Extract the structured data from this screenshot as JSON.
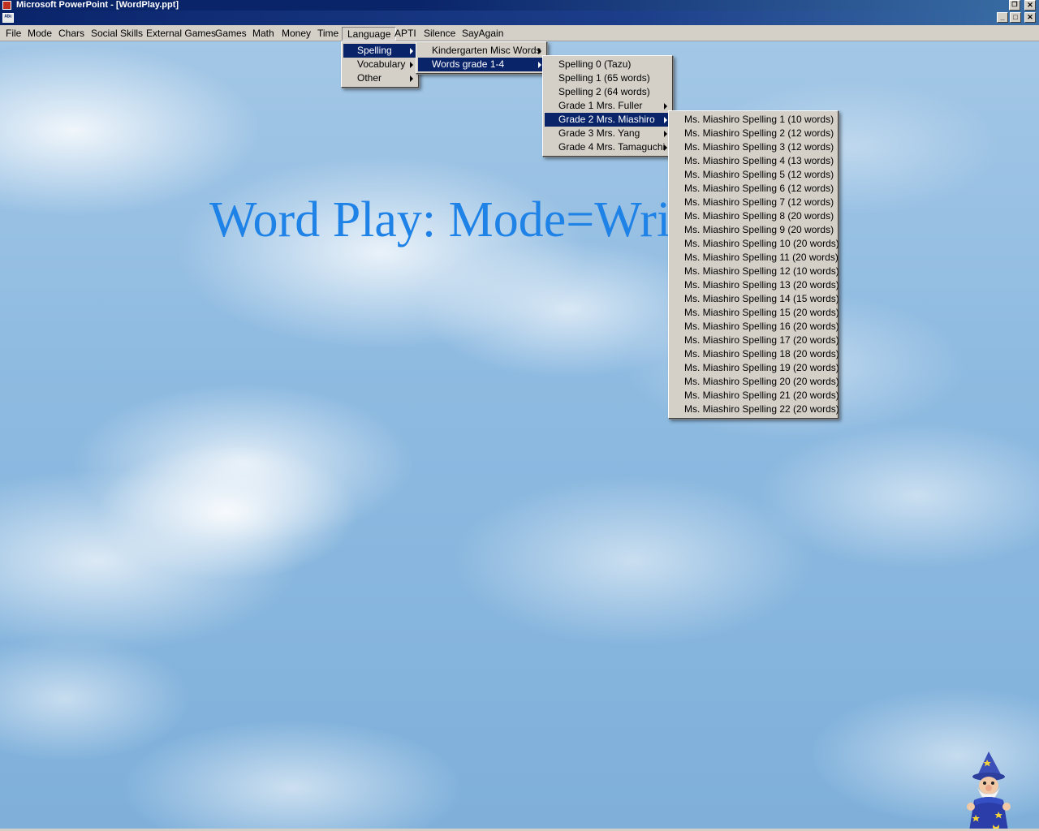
{
  "window": {
    "title": "Microsoft PowerPoint - [WordPlay.ppt]",
    "doc_icon_label": "ᴬᴮᶜ"
  },
  "menubar": {
    "items": [
      "File",
      "Mode",
      "Chars",
      "Social Skills",
      "External Games",
      "Games",
      "Math",
      "Money",
      "Time",
      "Language",
      "APTI",
      "Silence",
      "SayAgain"
    ],
    "active": "Language"
  },
  "language_menu": {
    "items": [
      {
        "label": "Spelling",
        "submenu": true,
        "selected": true
      },
      {
        "label": "Vocabulary",
        "submenu": true
      },
      {
        "label": "Other",
        "submenu": true
      }
    ]
  },
  "spelling_menu": {
    "items": [
      {
        "label": "Kindergarten Misc Words",
        "submenu": true
      },
      {
        "label": "Words grade 1-4",
        "submenu": true,
        "selected": true
      }
    ]
  },
  "grades_menu": {
    "items": [
      {
        "label": "Spelling 0 (Tazu)"
      },
      {
        "label": "Spelling 1 (65 words)"
      },
      {
        "label": "Spelling 2 (64 words)"
      },
      {
        "label": "Grade 1 Mrs. Fuller",
        "submenu": true
      },
      {
        "label": "Grade 2 Mrs. Miashiro",
        "submenu": true,
        "selected": true
      },
      {
        "label": "Grade 3 Mrs. Yang",
        "submenu": true
      },
      {
        "label": "Grade 4 Mrs. Tamaguchi",
        "submenu": true
      }
    ]
  },
  "miashiro_menu": {
    "items": [
      "Ms. Miashiro Spelling 1 (10 words)",
      "Ms. Miashiro Spelling 2 (12 words)",
      "Ms. Miashiro Spelling 3 (12 words)",
      "Ms. Miashiro Spelling 4 (13 words)",
      "Ms. Miashiro Spelling 5 (12 words)",
      "Ms. Miashiro Spelling 6 (12 words)",
      "Ms. Miashiro Spelling 7 (12 words)",
      "Ms. Miashiro Spelling 8 (20 words)",
      "Ms. Miashiro Spelling 9 (20 words)",
      "Ms. Miashiro Spelling 10 (20 words)",
      "Ms. Miashiro Spelling 11 (20 words)",
      "Ms. Miashiro Spelling 12 (10 words)",
      "Ms. Miashiro Spelling 13 (20 words)",
      "Ms. Miashiro Spelling 14 (15 words)",
      "Ms. Miashiro Spelling 15 (20 words)",
      "Ms. Miashiro Spelling 16 (20 words)",
      "Ms. Miashiro Spelling 17 (20 words)",
      "Ms. Miashiro Spelling 18 (20 words)",
      "Ms. Miashiro Spelling 19 (20 words)",
      "Ms. Miashiro Spelling 20 (20 words)",
      "Ms. Miashiro Spelling 21 (20 words)",
      "Ms. Miashiro Spelling 22 (20 words)"
    ]
  },
  "slide": {
    "title": "Word Play: Mode=Write"
  },
  "colors": {
    "title_text": "#1e82e6",
    "selection": "#0a246a",
    "menu_bg": "#d4d0c8"
  },
  "icons": {
    "app": "powerpoint-icon",
    "doc": "abc-document-icon",
    "assistant": "wizard-assistant-icon"
  }
}
